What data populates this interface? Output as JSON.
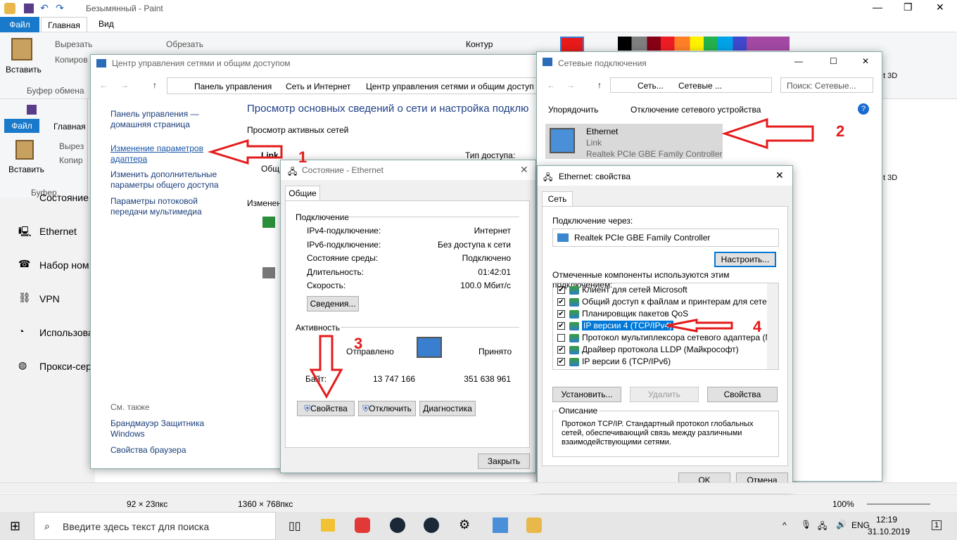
{
  "paint": {
    "title": "Безымянный - Paint",
    "tab_file": "Файл",
    "tab_home": "Главная",
    "tab_view": "Вид",
    "paste": "Вставить",
    "cut": "Вырезать",
    "copy": "Копиров",
    "crop": "Обрезать",
    "contour": "Контур",
    "clipboard": "Буфер обмена",
    "status_sel": "92 × 23пкс",
    "status_size": "1360 × 768пкс",
    "zoom": "100%"
  },
  "paint2": {
    "tab_file": "Файл",
    "tab_home": "Главная",
    "paste": "Вставить",
    "cut": "Вырез",
    "copy": "Копир",
    "clipboard": "Буфер обмена"
  },
  "settings": {
    "items": [
      "Ethernet",
      "Набор ном",
      "VPN",
      "Использова",
      "Прокси-сер"
    ],
    "partial": "Состояние"
  },
  "ncc": {
    "title": "Центр управления сетями и общим доступом",
    "breadcrumb": [
      "Панель управления",
      "Сеть и Интернет",
      "Центр управления сетями и общим доступ"
    ],
    "home_link": "Панель управления — домашняя страница",
    "change_adapter": "Изменение параметров адаптера",
    "change_sharing": "Изменить дополнительные параметры общего доступа",
    "streaming": "Параметры потоковой передачи мультимедиа",
    "heading": "Просмотр основных сведений о сети и настройка подклю",
    "active_nets": "Просмотр активных сетей",
    "net_name": "Link",
    "net_type": "Общ",
    "access_type": "Тип доступа:",
    "change": "Изменен",
    "see_also": "См. также",
    "firewall": "Брандмауэр Защитника Windows",
    "browser": "Свойства браузера"
  },
  "status": {
    "title": "Состояние - Ethernet",
    "tab": "Общие",
    "connection": "Подключение",
    "rows": [
      {
        "k": "IPv4-подключение:",
        "v": "Интернет"
      },
      {
        "k": "IPv6-подключение:",
        "v": "Без доступа к сети"
      },
      {
        "k": "Состояние среды:",
        "v": "Подключено"
      },
      {
        "k": "Длительность:",
        "v": "01:42:01"
      },
      {
        "k": "Скорость:",
        "v": "100.0 Мбит/с"
      }
    ],
    "details": "Сведения...",
    "activity": "Активность",
    "sent": "Отправлено",
    "received": "Принято",
    "bytes": "Байт:",
    "sent_val": "13 747 166",
    "recv_val": "351 638 961",
    "props": "Свойства",
    "disconnect": "Отключить",
    "diagnose": "Диагностика",
    "close": "Закрыть"
  },
  "netconn": {
    "title": "Сетевые подключения",
    "crumb1": "Сеть...",
    "crumb2": "Сетевые ...",
    "search": "Поиск: Сетевые...",
    "organize": "Упорядочить",
    "disable": "Отключение сетевого устройства",
    "adapter_name": "Ethernet",
    "adapter_net": "Link",
    "adapter_desc": "Realtek PCIe GBE Family Controller"
  },
  "props": {
    "title": "Ethernet: свойства",
    "tab": "Сеть",
    "connect_via": "Подключение через:",
    "adapter": "Realtek PCIe GBE Family Controller",
    "configure": "Настроить...",
    "components_label": "Отмеченные компоненты используются этим подключением:",
    "components": [
      {
        "label": "Клиент для сетей Microsoft",
        "checked": true
      },
      {
        "label": "Общий доступ к файлам и принтерам для сетей Mi",
        "checked": true
      },
      {
        "label": "Планировщик пакетов QoS",
        "checked": true
      },
      {
        "label": "IP версии 4 (TCP/IPv4)",
        "checked": true
      },
      {
        "label": "Протокол мультиплексора сетевого адаптера (Май",
        "checked": false
      },
      {
        "label": "Драйвер протокола LLDP (Майкрософт)",
        "checked": true
      },
      {
        "label": "IP версии 6 (TCP/IPv6)",
        "checked": true
      }
    ],
    "install": "Установить...",
    "remove": "Удалить",
    "properties": "Свойства",
    "desc_title": "Описание",
    "desc": "Протокол TCP/IP. Стандартный протокол глобальных сетей, обеспечивающий связь между различными взаимодействующими сетями.",
    "ok": "OK",
    "cancel": "Отмена"
  },
  "annotations": [
    "1",
    "2",
    "3",
    "4"
  ],
  "taskbar": {
    "search": "Введите здесь текст для поиска",
    "lang": "ENG",
    "time": "12:19",
    "date": "31.10.2019",
    "notif": "1"
  },
  "partial": {
    "p3d1": "t 3D",
    "p3d2": "t 3D"
  }
}
